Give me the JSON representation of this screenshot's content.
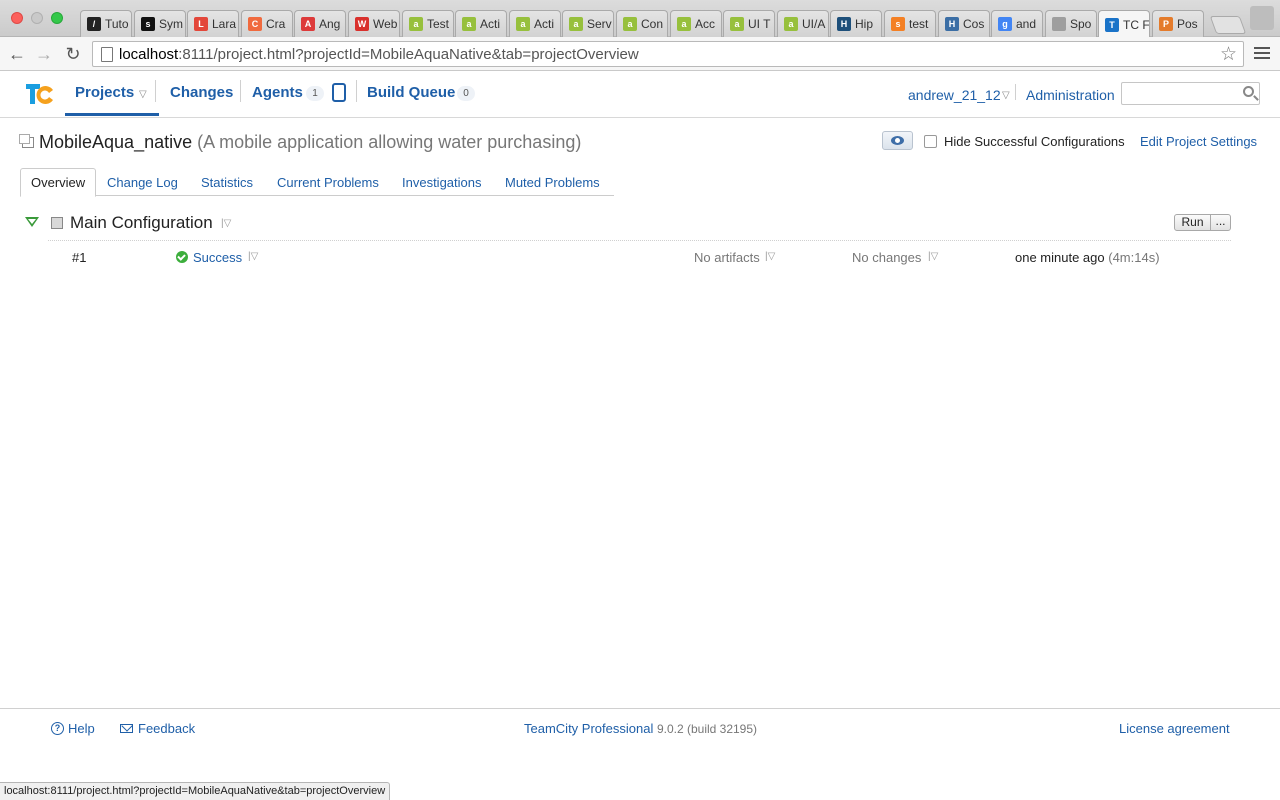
{
  "browser": {
    "tabs": [
      {
        "label": "Tuto",
        "fav": "#222",
        "glyph": "/"
      },
      {
        "label": "Sym",
        "fav": "#111",
        "glyph": "s"
      },
      {
        "label": "Lara",
        "fav": "#e3473a",
        "glyph": "L"
      },
      {
        "label": "Cra",
        "fav": "#f06a3e",
        "glyph": "C"
      },
      {
        "label": "Ang",
        "fav": "#dd3a3a",
        "glyph": "A"
      },
      {
        "label": "Web",
        "fav": "#d9302c",
        "glyph": "W"
      },
      {
        "label": "Test",
        "fav": "#97c03d",
        "glyph": "a"
      },
      {
        "label": "Acti",
        "fav": "#97c03d",
        "glyph": "a"
      },
      {
        "label": "Acti",
        "fav": "#97c03d",
        "glyph": "a"
      },
      {
        "label": "Serv",
        "fav": "#97c03d",
        "glyph": "a"
      },
      {
        "label": "Con",
        "fav": "#97c03d",
        "glyph": "a"
      },
      {
        "label": "Acc",
        "fav": "#97c03d",
        "glyph": "a"
      },
      {
        "label": "UI T",
        "fav": "#97c03d",
        "glyph": "a"
      },
      {
        "label": "UI/A",
        "fav": "#97c03d",
        "glyph": "a"
      },
      {
        "label": "Hip",
        "fav": "#1d4f7a",
        "glyph": "H"
      },
      {
        "label": "test",
        "fav": "#f48024",
        "glyph": "s"
      },
      {
        "label": "Cos",
        "fav": "#3b6ea5",
        "glyph": "H"
      },
      {
        "label": "and",
        "fav": "#4285f4",
        "glyph": "g"
      },
      {
        "label": "Spo",
        "fav": "#9e9e9e",
        "glyph": ""
      },
      {
        "label": "TC F",
        "fav": "#1a73c8",
        "glyph": "T",
        "active": true
      },
      {
        "label": "Pos",
        "fav": "#e47b2b",
        "glyph": "P"
      }
    ],
    "url_host": "localhost",
    "url_rest": ":8111/project.html?projectId=MobileAquaNative&tab=projectOverview",
    "status_url": "localhost:8111/project.html?projectId=MobileAquaNative&tab=projectOverview"
  },
  "header": {
    "nav": {
      "projects": "Projects",
      "changes": "Changes",
      "agents": "Agents",
      "agents_count": "1",
      "build_queue": "Build Queue",
      "queue_count": "0"
    },
    "user": "andrew_21_12",
    "administration": "Administration",
    "search_value": ""
  },
  "project": {
    "name": "MobileAqua_native",
    "description": "(A mobile application allowing water purchasing)",
    "hide_successful_label": "Hide Successful Configurations",
    "hide_successful_checked": false,
    "edit_settings": "Edit Project Settings"
  },
  "subtabs": [
    "Overview",
    "Change Log",
    "Statistics",
    "Current Problems",
    "Investigations",
    "Muted Problems"
  ],
  "configuration": {
    "name": "Main Configuration",
    "run_label": "Run",
    "more_label": "...",
    "build": {
      "number": "#1",
      "status": "Success",
      "artifacts": "No artifacts",
      "changes": "No changes",
      "time": "one minute ago",
      "duration": "(4m:14s)"
    }
  },
  "footer": {
    "help": "Help",
    "feedback": "Feedback",
    "product": "TeamCity Professional",
    "version": "9.0.2 (build 32195)",
    "license": "License agreement"
  },
  "colors": {
    "link": "#1f5fa8",
    "success": "#3cae3c"
  }
}
